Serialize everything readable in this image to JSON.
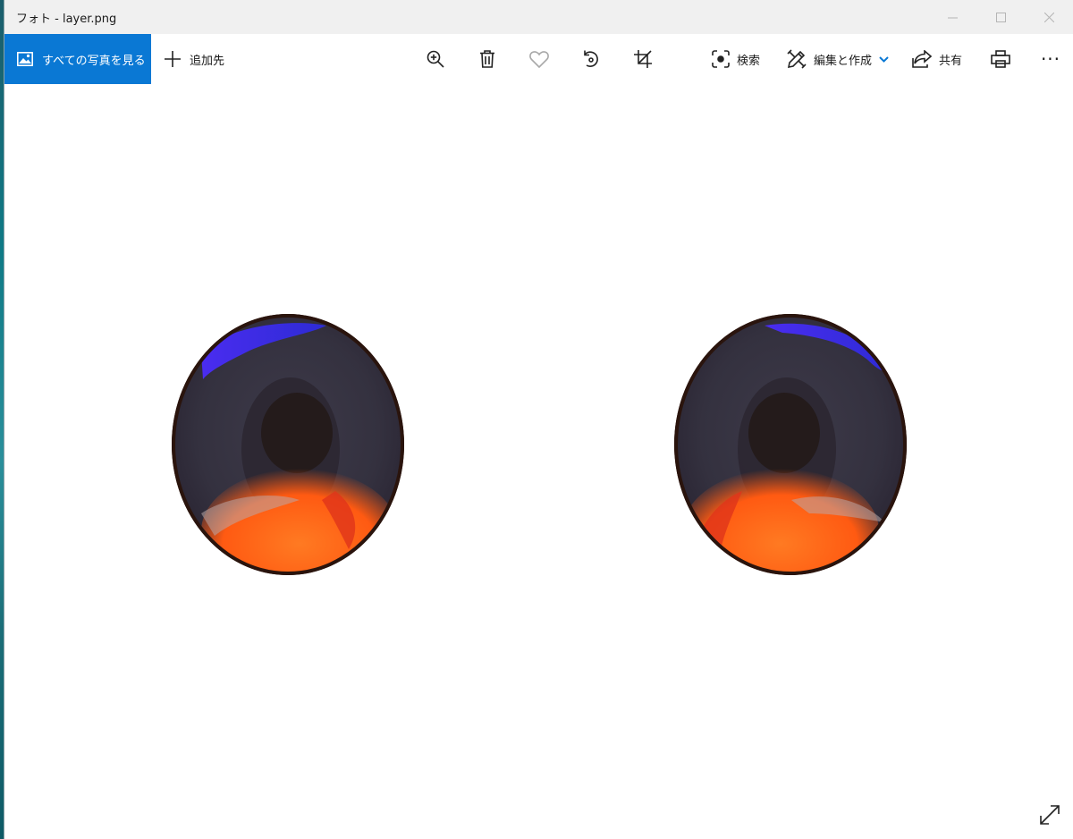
{
  "window": {
    "title": "フォト - layer.png",
    "controls": {
      "minimize": "—",
      "maximize": "☐",
      "close": "✕"
    }
  },
  "toolbar": {
    "all_photos_label": "すべての写真を見る",
    "add_to_label": "追加先",
    "search_label": "検索",
    "edit_create_label": "編集と作成",
    "share_label": "共有",
    "more_label": "···"
  },
  "icons": {
    "all_photos": "image-icon",
    "add_to": "plus-icon",
    "zoom": "zoom-in-icon",
    "delete": "trash-icon",
    "favorite": "heart-icon",
    "rotate": "rotate-icon",
    "crop": "crop-icon",
    "search": "visual-search-icon",
    "edit": "edit-create-icon",
    "share": "share-icon",
    "print": "printer-icon",
    "expand": "expand-icon"
  },
  "colors": {
    "accent": "#0a78d4",
    "titlebar_bg": "#f0f0f0",
    "canvas_bg": "#ffffff",
    "eye_iris": "#34313f",
    "eye_pupil": "#241b1b",
    "eye_highlight_blue": "#3f2ee0",
    "eye_glow_orange": "#ff6a1c",
    "eye_rim": "#2a140d"
  }
}
